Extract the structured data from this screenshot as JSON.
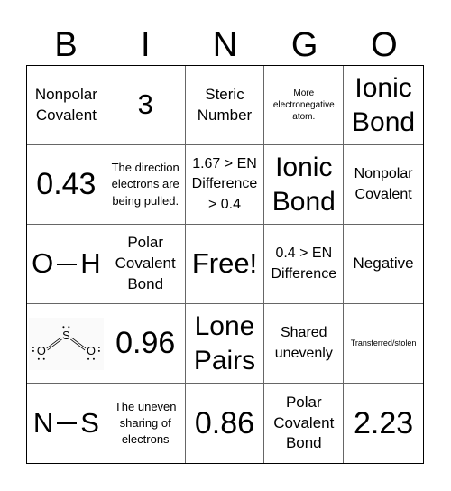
{
  "header": [
    "B",
    "I",
    "N",
    "G",
    "O"
  ],
  "cells": [
    {
      "text": "Nonpolar Covalent",
      "size": "md"
    },
    {
      "text": "3",
      "size": "lg"
    },
    {
      "text": "Steric Number",
      "size": "md"
    },
    {
      "text": "More electronegative atom.",
      "size": "xs"
    },
    {
      "text": "Ionic Bond",
      "size": "l2"
    },
    {
      "text": "0.43",
      "size": "xl"
    },
    {
      "text": "The direction electrons are being pulled.",
      "size": "sm"
    },
    {
      "text": "1.67 > EN Difference > 0.4",
      "size": "md2"
    },
    {
      "text": "Ionic Bond",
      "size": "l2"
    },
    {
      "text": "Nonpolar Covalent",
      "size": "md2"
    },
    {
      "text": "O—H",
      "size": "bond",
      "atoms": [
        "O",
        "H"
      ]
    },
    {
      "text": "Polar Covalent Bond",
      "size": "md"
    },
    {
      "text": "Free!",
      "size": "lg"
    },
    {
      "text": "0.4 > EN Difference",
      "size": "md2"
    },
    {
      "text": "Negative",
      "size": "md"
    },
    {
      "text": "SO2 Lewis structure",
      "size": "lewis"
    },
    {
      "text": "0.96",
      "size": "xl"
    },
    {
      "text": "Lone Pairs",
      "size": "l2"
    },
    {
      "text": "Shared unevenly",
      "size": "md2"
    },
    {
      "text": "Transferred/stolen",
      "size": "xxs"
    },
    {
      "text": "N—S",
      "size": "bond",
      "atoms": [
        "N",
        "S"
      ]
    },
    {
      "text": "The uneven sharing of electrons",
      "size": "sm"
    },
    {
      "text": "0.86",
      "size": "xl"
    },
    {
      "text": "Polar Covalent Bond",
      "size": "md"
    },
    {
      "text": "2.23",
      "size": "xl"
    }
  ]
}
